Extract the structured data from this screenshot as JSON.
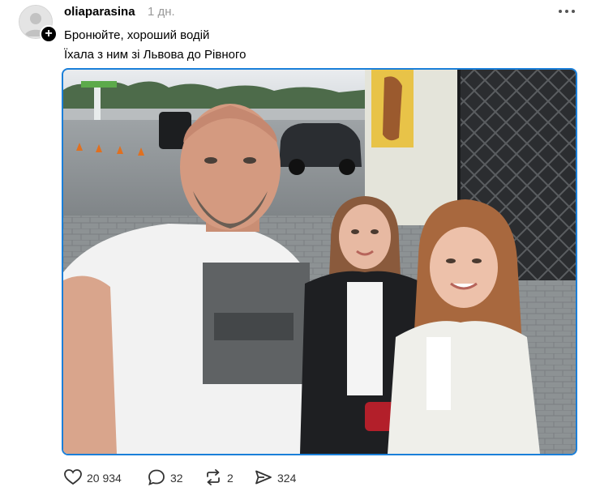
{
  "post": {
    "author": "oliaparasina",
    "time": "1 дн.",
    "caption": [
      "Бронюйте, хороший водій",
      "Їхала з ним зі Львова до Рівного"
    ],
    "follow_symbol": "+",
    "more_icon": "more-dots-icon"
  },
  "actions": {
    "likes": "20 934",
    "comments": "32",
    "reposts": "2",
    "shares": "324",
    "icons": [
      "heart-icon",
      "comment-bubble-icon",
      "repost-icon",
      "share-icon"
    ]
  },
  "colors": {
    "photo_focus_border": "#1a7fd9",
    "timestamp": "#999999",
    "text": "#000000"
  }
}
